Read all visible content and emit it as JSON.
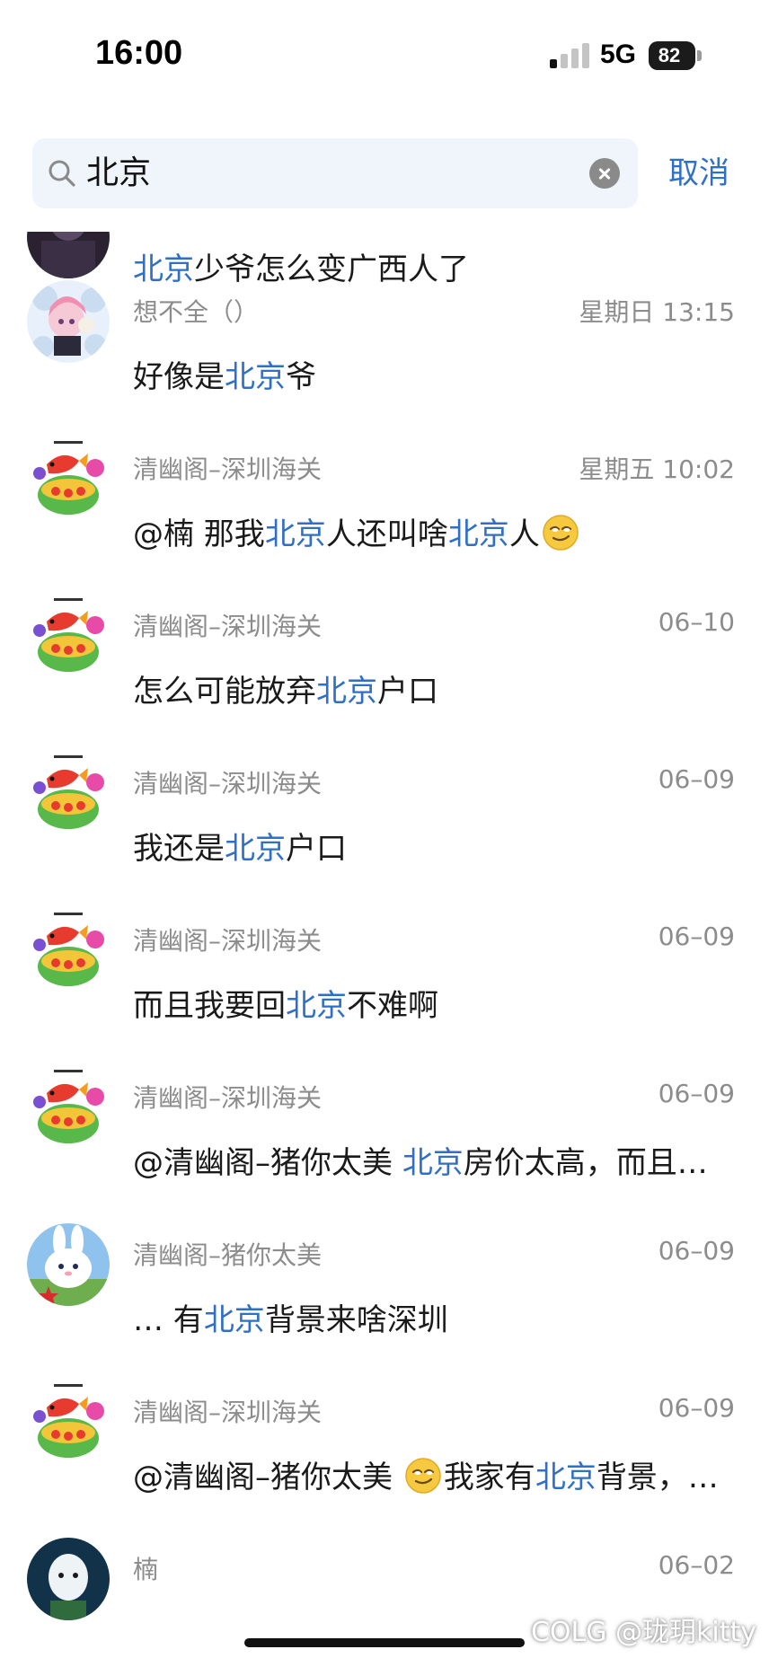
{
  "status_bar": {
    "time": "16:00",
    "network": "5G",
    "battery": "82"
  },
  "search": {
    "query": "北京",
    "cancel_label": "取消"
  },
  "results": [
    {
      "sender": "",
      "time": "",
      "message": [
        {
          "t": "北京",
          "h": true
        },
        {
          "t": "少爷怎么变广西人了"
        }
      ],
      "avatar": "dark"
    },
    {
      "sender": "想不全（）",
      "time": "星期日 13:15",
      "message": [
        {
          "t": "好像是"
        },
        {
          "t": "北京",
          "h": true
        },
        {
          "t": "爷"
        }
      ],
      "avatar": "anime"
    },
    {
      "sender": "清幽阁–深圳海关",
      "time": "星期五 10:02",
      "message": [
        {
          "t": "@楠  那我"
        },
        {
          "t": "北京",
          "h": true
        },
        {
          "t": "人还叫啥"
        },
        {
          "t": "北京",
          "h": true
        },
        {
          "t": "人"
        },
        {
          "emoji": "smirk-emoji"
        }
      ],
      "avatar": "fish"
    },
    {
      "sender": "清幽阁–深圳海关",
      "time": "06–10",
      "message": [
        {
          "t": "怎么可能放弃"
        },
        {
          "t": "北京",
          "h": true
        },
        {
          "t": "户口"
        }
      ],
      "avatar": "fish"
    },
    {
      "sender": "清幽阁–深圳海关",
      "time": "06–09",
      "message": [
        {
          "t": "我还是"
        },
        {
          "t": "北京",
          "h": true
        },
        {
          "t": "户口"
        }
      ],
      "avatar": "fish"
    },
    {
      "sender": "清幽阁–深圳海关",
      "time": "06–09",
      "message": [
        {
          "t": "而且我要回"
        },
        {
          "t": "北京",
          "h": true
        },
        {
          "t": "不难啊"
        }
      ],
      "avatar": "fish"
    },
    {
      "sender": "清幽阁–深圳海关",
      "time": "06–09",
      "message": [
        {
          "t": "@清幽阁–猪你太美  "
        },
        {
          "t": "北京",
          "h": true
        },
        {
          "t": "房价太高，而且…"
        }
      ],
      "avatar": "fish"
    },
    {
      "sender": "清幽阁–猪你太美",
      "time": "06–09",
      "message": [
        {
          "t": "… 有"
        },
        {
          "t": "北京",
          "h": true
        },
        {
          "t": "背景来啥深圳"
        }
      ],
      "avatar": "bunny"
    },
    {
      "sender": "清幽阁–深圳海关",
      "time": "06–09",
      "message": [
        {
          "t": "@清幽阁–猪你太美 "
        },
        {
          "emoji": "smirk-emoji"
        },
        {
          "t": "我家有"
        },
        {
          "t": "北京",
          "h": true
        },
        {
          "t": "背景，…"
        }
      ],
      "avatar": "fish"
    },
    {
      "sender": "楠",
      "time": "06–02",
      "message": [],
      "avatar": "ghost"
    }
  ],
  "watermark": "COLG @珑玥kitty",
  "colors": {
    "accent": "#2f6fc6",
    "secondary_text": "#8c8c8c",
    "search_bg": "#f0f5fb"
  }
}
